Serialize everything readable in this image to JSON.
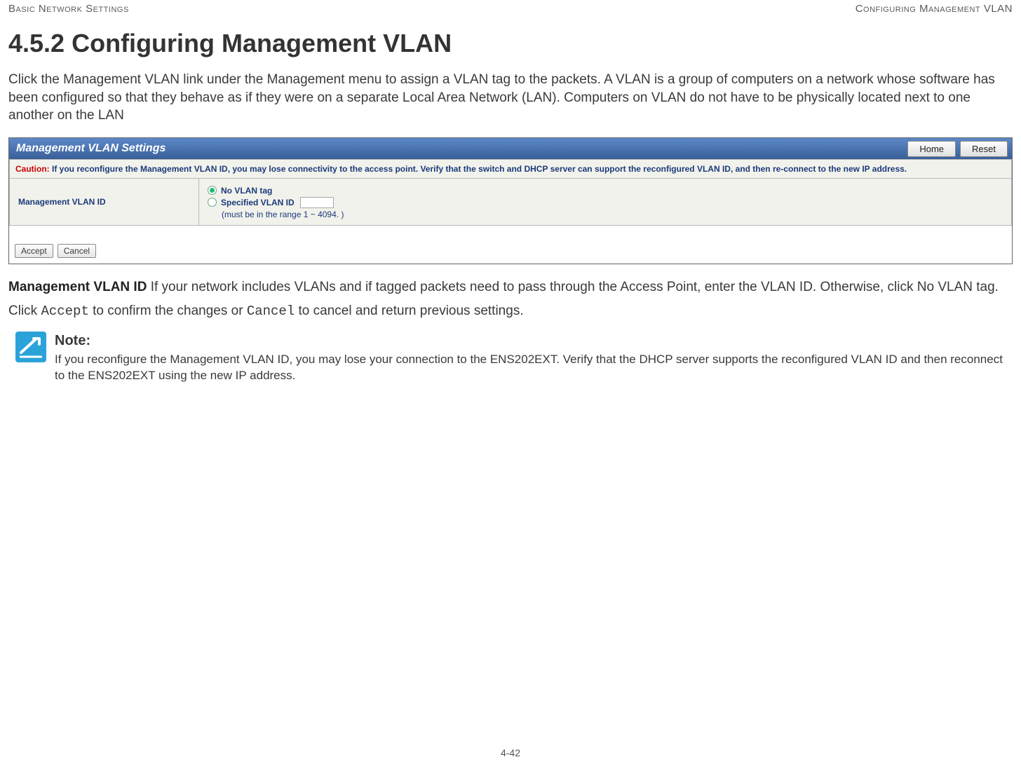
{
  "header": {
    "left": "Basic Network Settings",
    "right": "Configuring Management VLAN"
  },
  "section": {
    "number": "4.5.2",
    "title": "Configuring Management VLAN"
  },
  "intro": "Click the Management VLAN link under the Management menu to assign a VLAN tag to the packets. A VLAN is a group of computers on a network whose software has been configured so that they behave as if they were on a separate Local Area Network (LAN). Computers on VLAN do not have to be physically located next to one another on the LAN",
  "screenshot": {
    "title": "Management VLAN Settings",
    "buttons": {
      "home": "Home",
      "reset": "Reset"
    },
    "caution": {
      "label": "Caution:",
      "text": "If you reconfigure the Management VLAN ID, you may lose connectivity to the access point. Verify that the switch and DHCP server can support the reconfigured VLAN ID, and then re-connect to the new IP address."
    },
    "row": {
      "label": "Management VLAN ID",
      "opt_no_tag": "No VLAN tag",
      "opt_specified": "Specified VLAN ID",
      "range_hint": "(must be in the range 1 ~ 4094. )"
    },
    "footer": {
      "accept": "Accept",
      "cancel": "Cancel"
    }
  },
  "field_desc": {
    "name": "Management VLAN ID",
    "text": "  If your network includes VLANs and if tagged packets need to pass through the Access Point, enter the VLAN ID. Otherwise, click No VLAN tag."
  },
  "action": {
    "pre": "Click ",
    "accept": "Accept",
    "mid": " to confirm the changes or ",
    "cancel": "Cancel",
    "post": " to cancel and return previous settings."
  },
  "note": {
    "label": "Note:",
    "text": "If you reconfigure the Management VLAN ID, you may lose your connection to the ENS202EXT. Verify that the DHCP server supports the reconfigured VLAN ID and then reconnect to the ENS202EXT using the new IP address."
  },
  "page_number": "4-42"
}
